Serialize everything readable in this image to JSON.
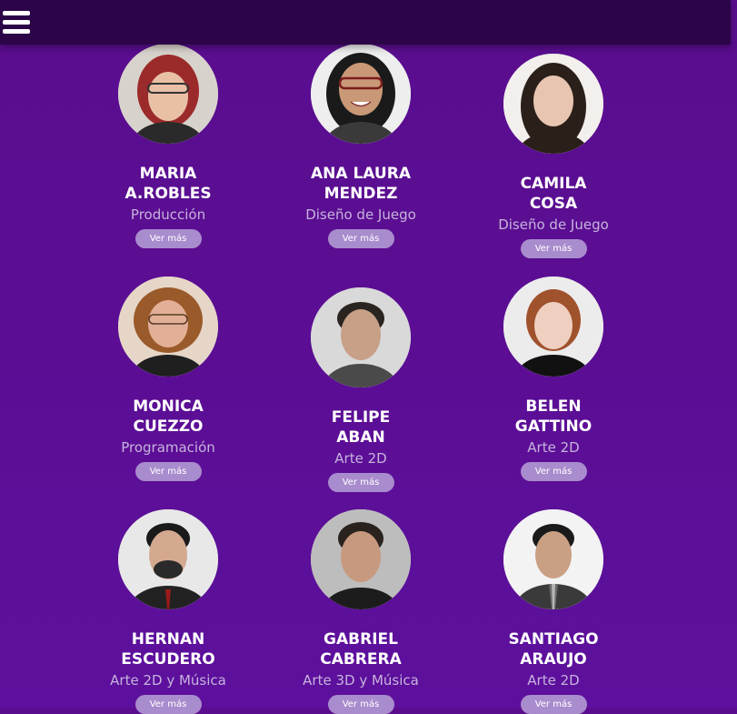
{
  "nav": {
    "menu_icon": "hamburger-menu-icon"
  },
  "team": [
    {
      "name": "MARIA A.ROBLES",
      "role": "Producción",
      "button": "Ver más",
      "photo": "portrait-woman-red-hair-glasses"
    },
    {
      "name": "ANA LAURA MENDEZ",
      "role": "Diseño de Juego",
      "button": "Ver más",
      "photo": "portrait-woman-dark-hair-glasses"
    },
    {
      "name": "CAMILA COSA",
      "role": "Diseño de Juego",
      "button": "Ver más",
      "photo": "portrait-woman-long-dark-hair"
    },
    {
      "name": "MONICA CUEZZO",
      "role": "Programación",
      "button": "Ver más",
      "photo": "portrait-woman-curly-hair-glasses"
    },
    {
      "name": "FELIPE ABAN",
      "role": "Arte 2D",
      "button": "Ver más",
      "photo": "portrait-man-dark-hair"
    },
    {
      "name": "BELEN GATTINO",
      "role": "Arte 2D",
      "button": "Ver más",
      "photo": "portrait-woman-auburn-short-hair"
    },
    {
      "name": "HERNAN ESCUDERO",
      "role": "Arte 2D y Música",
      "button": "Ver más",
      "photo": "portrait-man-beard-suit"
    },
    {
      "name": "GABRIEL CABRERA",
      "role": "Arte 3D y Música",
      "button": "Ver más",
      "photo": "portrait-man-short-hair"
    },
    {
      "name": "SANTIAGO ARAUJO",
      "role": "Arte 2D",
      "button": "Ver más",
      "photo": "portrait-man-suit-tie"
    }
  ],
  "colors": {
    "background": "#5b0e94",
    "topbar": "#2c0548",
    "name_text": "#ffffff",
    "role_text": "#c7b3dd",
    "button_bg": "#a98ccd"
  }
}
